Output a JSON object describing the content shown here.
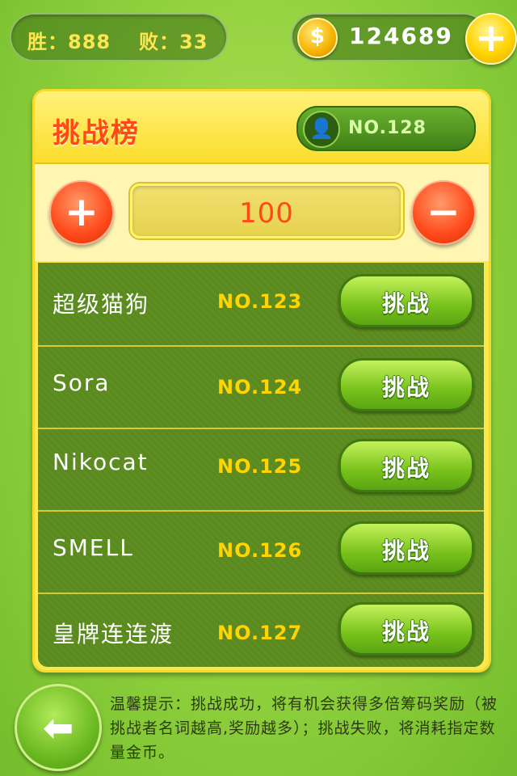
{
  "stats": {
    "win_label": "胜：888",
    "loss_label": "败：33"
  },
  "coins": {
    "icon": "dollar-coin-icon",
    "glyph": "$",
    "value": "124689",
    "add_glyph": "+"
  },
  "panel": {
    "title": "挑战榜",
    "rank": {
      "avatar_glyph": "👤",
      "text": "NO.128"
    },
    "bet": {
      "plus_glyph": "+",
      "minus_glyph": "−",
      "value": "100"
    }
  },
  "players": [
    {
      "name": "超级猫狗",
      "rank": "NO.123",
      "button": "挑战"
    },
    {
      "name": "Sora",
      "rank": "NO.124",
      "button": "挑战"
    },
    {
      "name": "Nikocat",
      "rank": "NO.125",
      "button": "挑战"
    },
    {
      "name": "SMELL",
      "rank": "NO.126",
      "button": "挑战"
    },
    {
      "name": "皇牌连连渡",
      "rank": "NO.127",
      "button": "挑战"
    }
  ],
  "footer": {
    "back_glyph": "⬅",
    "tip": "温馨提示：挑战成功，将有机会获得多倍筹码奖励（被挑战者名词越高,奖励越多）；挑战失败，将消耗指定数量金币。"
  },
  "colors": {
    "accent": "#ff4a16",
    "rank_yellow": "#ffd400",
    "list_bg": "#5b8b20",
    "panel_bg": "#fbe84a"
  }
}
